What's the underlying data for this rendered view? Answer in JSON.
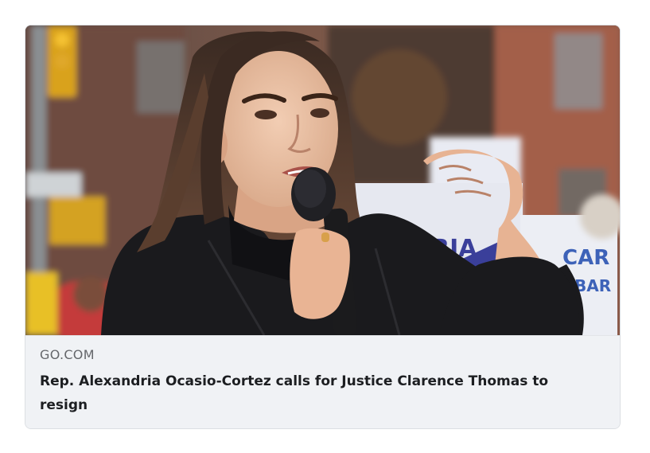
{
  "link_preview": {
    "image_alt": "Alexandria Ocasio-Cortez speaking into a microphone at a rally",
    "domain": "GO.COM",
    "headline": "Rep. Alexandria Ocasio-Cortez calls for Justice Clarence Thomas to resign",
    "sign_left_text": "RIA",
    "sign_right_text_1": "CAR",
    "sign_right_text_2": "BAR"
  },
  "colors": {
    "card_background": "#f0f2f5",
    "domain_text": "#65676b",
    "headline_text": "#1c1e21",
    "coat": "#1a1a1d",
    "sign_blue": "#3a3f9a",
    "sign_white": "#eaeaf2"
  }
}
